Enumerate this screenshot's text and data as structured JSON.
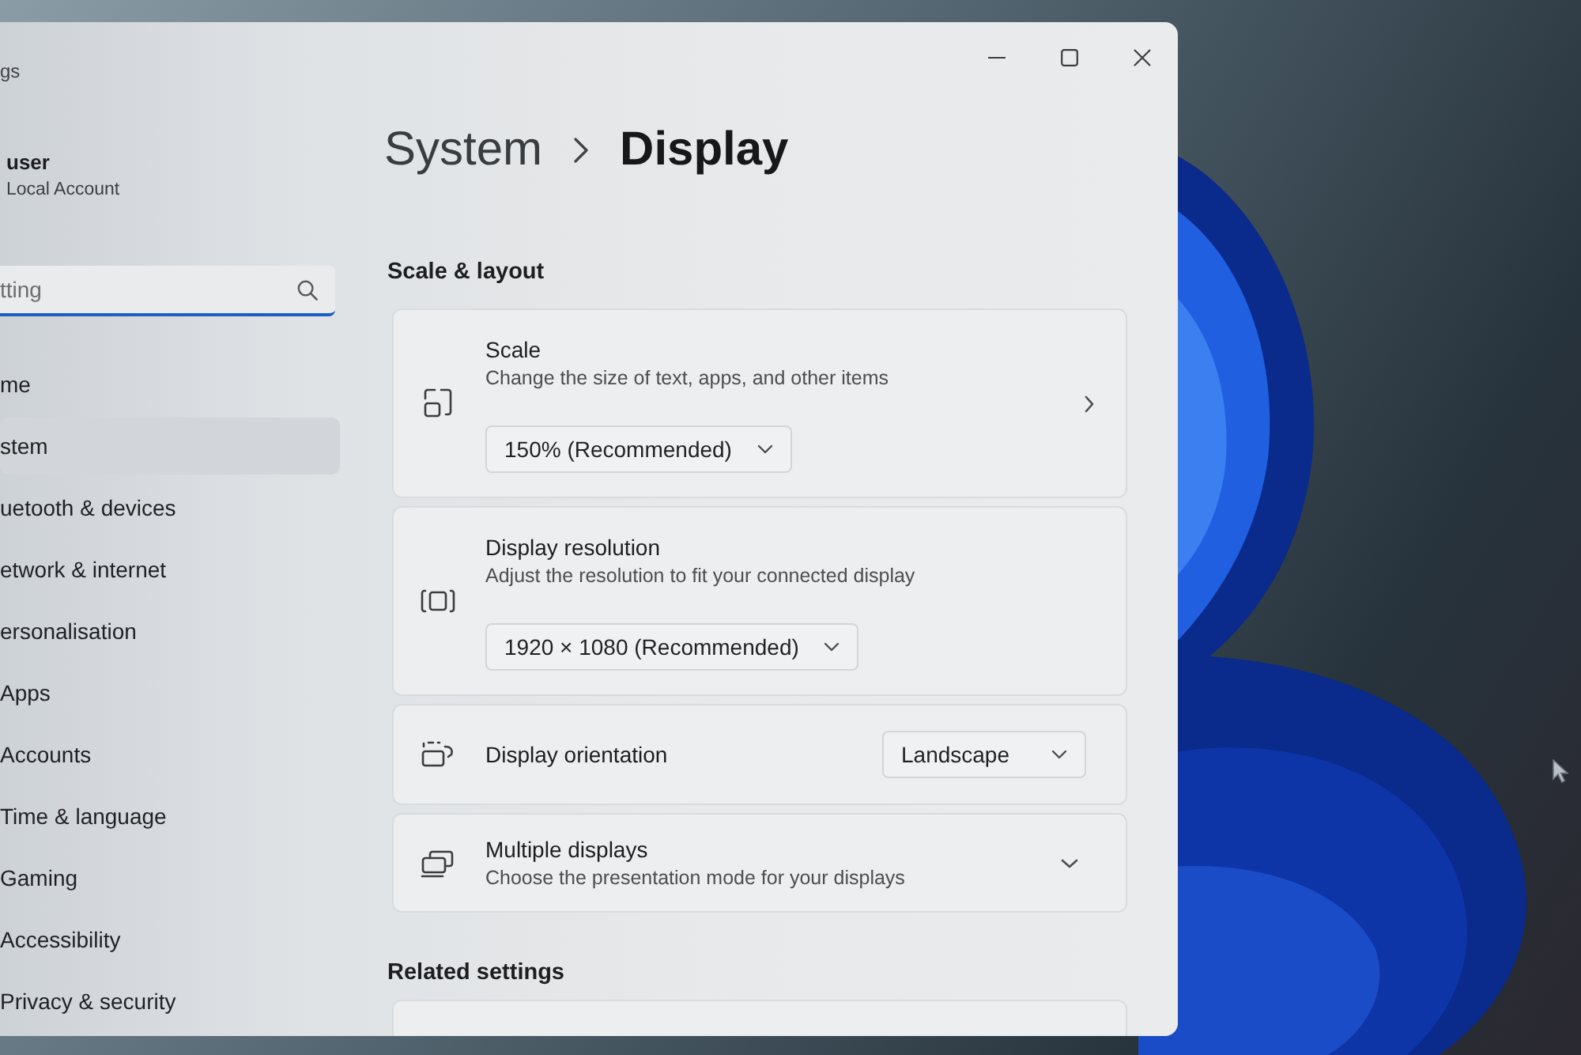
{
  "window": {
    "title": "gs"
  },
  "account": {
    "name": "user",
    "type": "Local Account"
  },
  "search": {
    "placeholder": "tting",
    "focused": true
  },
  "sidebar": {
    "items": [
      {
        "label": "me",
        "selected": false
      },
      {
        "label": "stem",
        "selected": true
      },
      {
        "label": "uetooth & devices",
        "selected": false
      },
      {
        "label": "etwork & internet",
        "selected": false
      },
      {
        "label": "ersonalisation",
        "selected": false
      },
      {
        "label": "Apps",
        "selected": false
      },
      {
        "label": "Accounts",
        "selected": false
      },
      {
        "label": "Time & language",
        "selected": false
      },
      {
        "label": "Gaming",
        "selected": false
      },
      {
        "label": "Accessibility",
        "selected": false
      },
      {
        "label": "Privacy & security",
        "selected": false
      }
    ]
  },
  "breadcrumb": [
    "System",
    "Display"
  ],
  "sections": [
    {
      "heading": "Scale & layout",
      "cards": [
        {
          "kind": "stacked",
          "title": "Scale",
          "description": "Change the size of text, apps, and other items",
          "value": "150% (Recommended)",
          "navigates": true
        },
        {
          "kind": "stacked",
          "title": "Display resolution",
          "description": "Adjust the resolution to fit your connected display",
          "value": "1920 × 1080 (Recommended)",
          "navigates": false
        },
        {
          "kind": "inline",
          "title": "Display orientation",
          "value": "Landscape"
        },
        {
          "kind": "expander",
          "title": "Multiple displays",
          "description": "Choose the presentation mode for your displays",
          "expanded": false
        }
      ]
    },
    {
      "heading": "Related settings",
      "cards": [
        {
          "kind": "cut"
        }
      ]
    }
  ]
}
